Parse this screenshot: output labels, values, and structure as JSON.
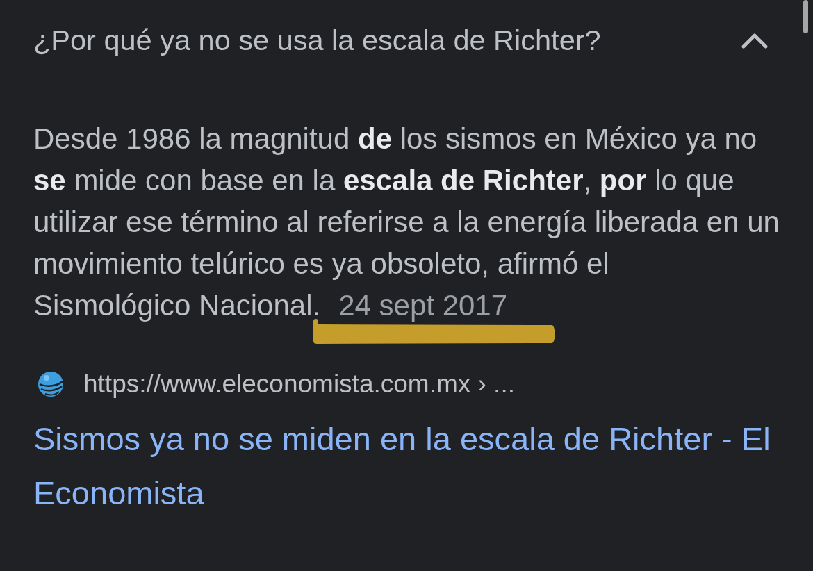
{
  "question": {
    "text": "¿Por qué ya no se usa la escala de Richter?",
    "expanded": true
  },
  "answer": {
    "snippet": "Desde 1986 la magnitud **de** los sismos en México ya no **se** mide con base en la **escala de Richter**, **por** lo que utilizar ese término al referirse a la energía liberada en un movimiento telúrico es ya obsoleto, afirmó el Sismológico Nacional.",
    "date": "24 sept 2017"
  },
  "source": {
    "url": "https://www.eleconomista.com.mx › ...",
    "title": "Sismos ya no se miden en la escala de Richter - El Economista"
  }
}
